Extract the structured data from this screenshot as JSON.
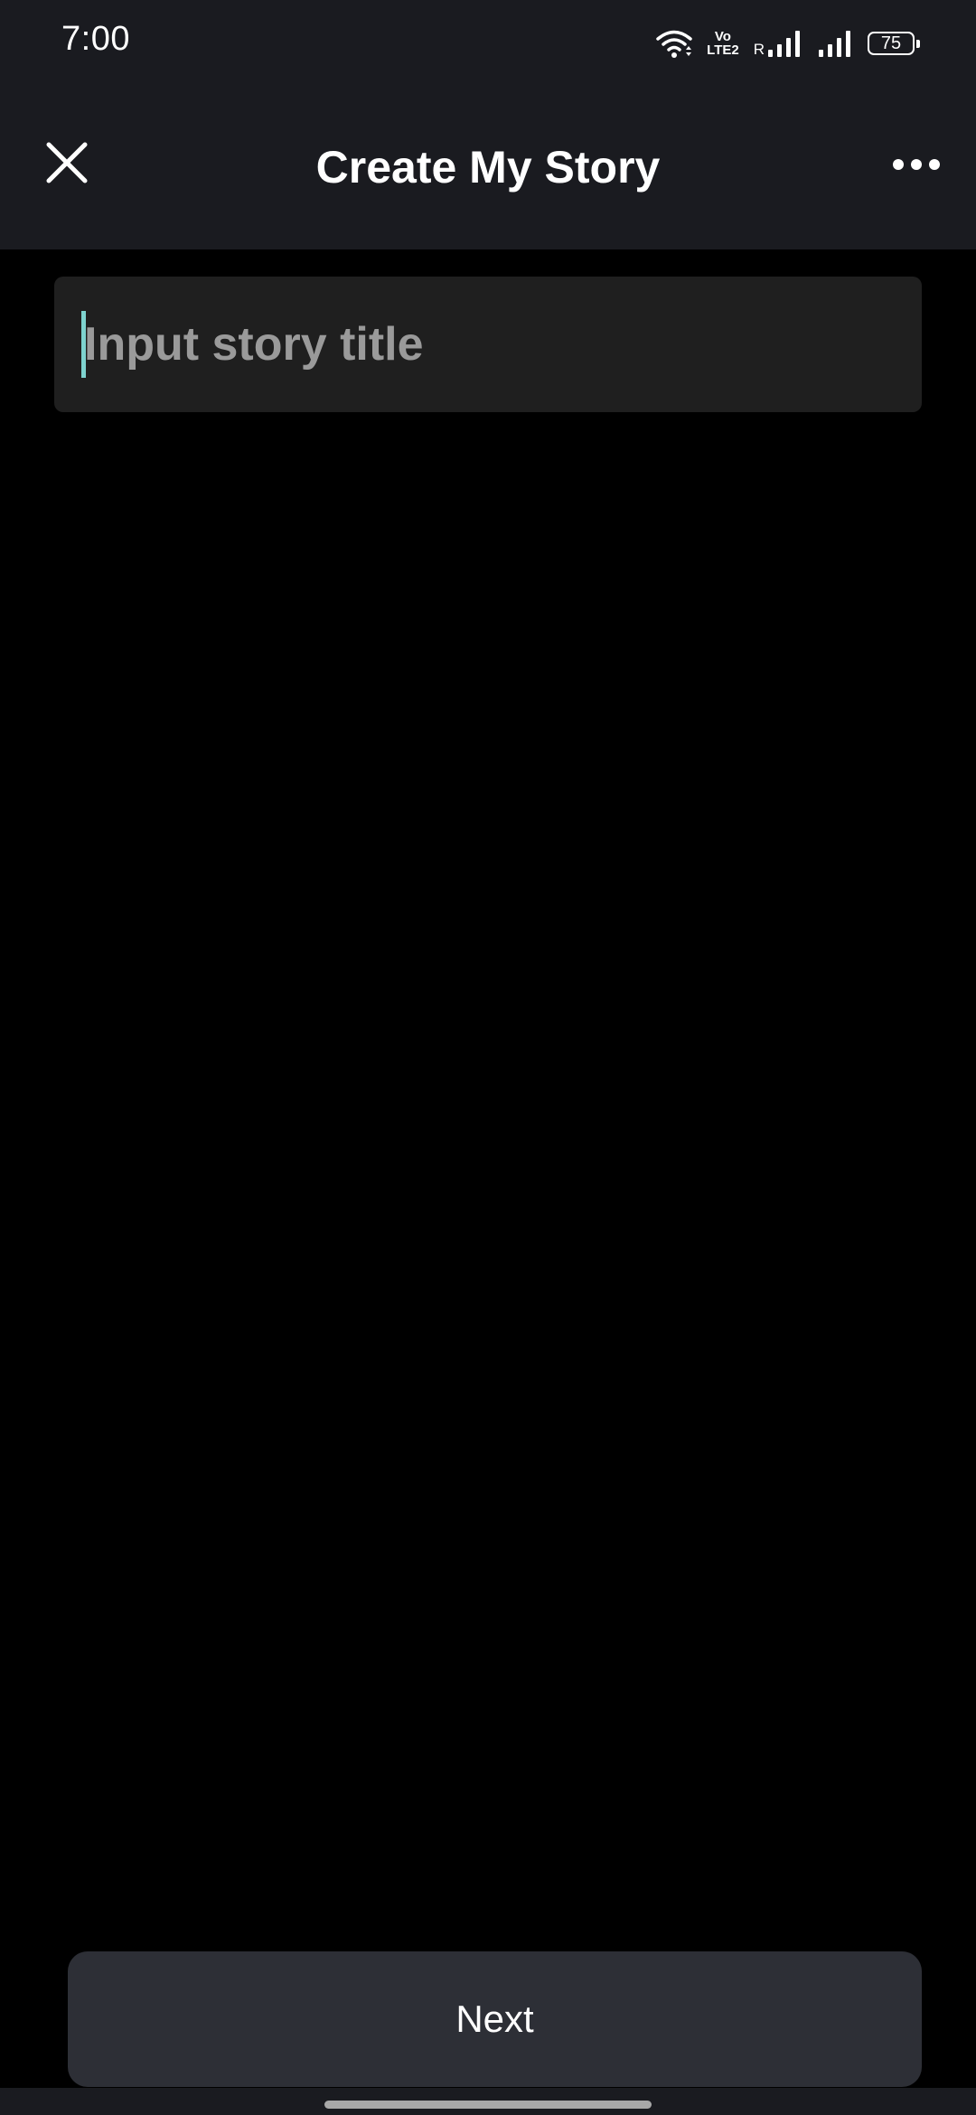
{
  "status_bar": {
    "time": "7:00",
    "volte_top": "Vo",
    "volte_bottom": "LTE2",
    "roaming": "R",
    "battery_level": "75",
    "icons": [
      "wifi-icon",
      "volte-icon",
      "signal-icon",
      "signal-icon",
      "battery-icon"
    ]
  },
  "header": {
    "title": "Create My Story",
    "close_icon": "close-icon",
    "more_icon": "more-horizontal-icon"
  },
  "story_form": {
    "title_value": "",
    "title_placeholder": "Input story title",
    "cursor_color": "#7ed3cf"
  },
  "footer": {
    "next_label": "Next"
  },
  "colors": {
    "background": "#000000",
    "app_bar": "#1a1b20",
    "input_background": "#1f1f1f",
    "button_background": "#2d2f36",
    "placeholder_text": "#9a9a9a"
  }
}
